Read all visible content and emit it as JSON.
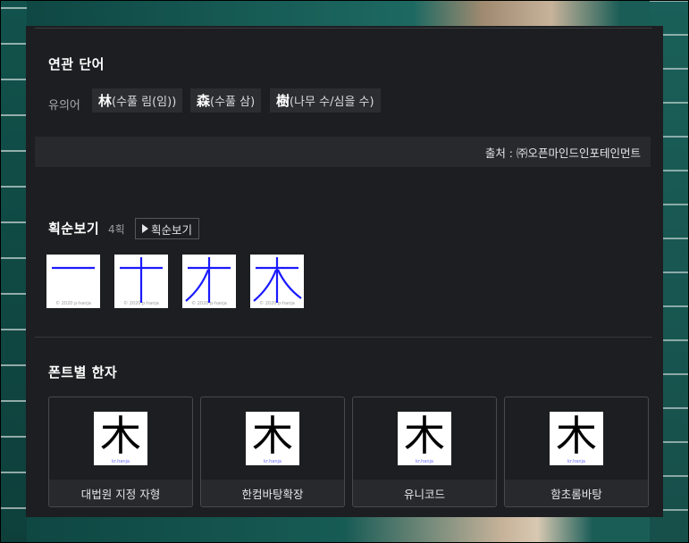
{
  "related": {
    "title": "연관 단어",
    "synonym_label": "유의어",
    "synonyms": [
      {
        "han": "林",
        "reading": "(수풀 림(임))"
      },
      {
        "han": "森",
        "reading": "(수풀 삼)"
      },
      {
        "han": "樹",
        "reading": "(나무 수/심을 수)"
      }
    ],
    "source": "출처 : ㈜오픈마인드인포테인먼트"
  },
  "stroke": {
    "title": "획순보기",
    "count": "4획",
    "button_label": "획순보기",
    "steps": [
      1,
      2,
      3,
      4
    ],
    "watermark": "© 2020 p-hanja"
  },
  "fonts": {
    "title": "폰트별 한자",
    "glyph": "木",
    "mark": "kr.hanja",
    "cards": [
      {
        "label": "대법원 지정 자형"
      },
      {
        "label": "한컴바탕확장"
      },
      {
        "label": "유니코드"
      },
      {
        "label": "함초롬바탕"
      }
    ]
  },
  "colors": {
    "panel_bg": "#1d1e21",
    "stroke_color": "#1a1aff"
  }
}
